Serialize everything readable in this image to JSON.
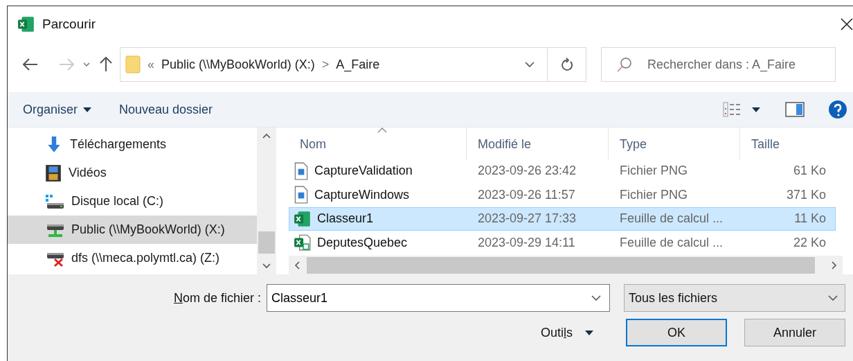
{
  "window": {
    "title": "Parcourir"
  },
  "address": {
    "parts": [
      {
        "text": "«"
      },
      {
        "text": "Public (\\\\MyBookWorld) (X:)"
      },
      {
        "text": ">"
      },
      {
        "text": "A_Faire"
      }
    ]
  },
  "search": {
    "placeholder": "Rechercher dans : A_Faire"
  },
  "toolbar": {
    "organise": "Organiser",
    "new_folder": "Nouveau dossier"
  },
  "sidebar": {
    "items": [
      {
        "label": "Téléchargements",
        "kind": "download",
        "selected": false
      },
      {
        "label": "Vidéos",
        "kind": "video",
        "selected": false
      },
      {
        "label": "Disque local (C:)",
        "kind": "drive",
        "selected": false
      },
      {
        "label": "Public (\\\\MyBookWorld) (X:)",
        "kind": "network",
        "selected": true
      },
      {
        "label": "dfs (\\\\meca.polymtl.ca) (Z:)",
        "kind": "disconnected",
        "selected": false
      }
    ]
  },
  "table": {
    "columns": [
      "Nom",
      "Modifié le",
      "Type",
      "Taille"
    ],
    "rows": [
      {
        "kind": "png",
        "cells": [
          "CaptureValidation",
          "2023-09-26 23:42",
          "Fichier PNG",
          "61 Ko"
        ],
        "selected": false
      },
      {
        "kind": "png",
        "cells": [
          "CaptureWindows",
          "2023-09-26 11:57",
          "Fichier PNG",
          "371 Ko"
        ],
        "selected": false
      },
      {
        "kind": "xlsx",
        "cells": [
          "Classeur1",
          "2023-09-27 17:33",
          "Feuille de calcul ...",
          "11 Ko"
        ],
        "selected": true
      },
      {
        "kind": "xlsm",
        "cells": [
          "DeputesQuebec",
          "2023-09-29 14:11",
          "Feuille de calcul ...",
          "22 Ko"
        ],
        "selected": false
      }
    ]
  },
  "filename": {
    "label": [
      {
        "text": "N",
        "underlined": true
      },
      {
        "text": "om de fichier :",
        "underlined": false
      }
    ],
    "value": "Classeur1"
  },
  "filter": {
    "value": "Tous les fichiers"
  },
  "tools": {
    "label": [
      {
        "text": "Outi",
        "underlined": false
      },
      {
        "text": "l",
        "underlined": true
      },
      {
        "text": "s",
        "underlined": false
      }
    ]
  },
  "buttons": [
    {
      "label": "OK",
      "kind": "default"
    },
    {
      "label": "Annuler",
      "kind": "normal"
    }
  ]
}
